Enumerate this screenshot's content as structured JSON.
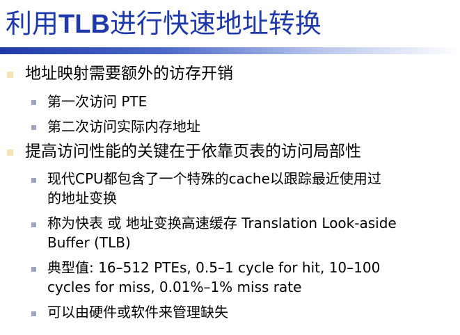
{
  "title": {
    "cn1": "利用",
    "latin": "TLB",
    "cn2": "进行快速地址转换"
  },
  "bullets": [
    {
      "text": "地址映射需要额外的访存开销",
      "children": [
        {
          "lines": [
            "第一次访问 PTE"
          ]
        },
        {
          "lines": [
            "第二次访问实际内存地址"
          ]
        }
      ]
    },
    {
      "text": "提高访问性能的关键在于依靠页表的访问局部性",
      "children": [
        {
          "lines": [
            "现代CPU都包含了一个特殊的cache以跟踪最近使用过",
            "的地址变换"
          ]
        },
        {
          "lines": [
            "称为快表 或 地址变换高速缓存 Translation Look-aside",
            "Buffer (TLB)"
          ]
        },
        {
          "lines": [
            "典型值: 16–512 PTEs, 0.5–1 cycle for hit, 10–100",
            "cycles for miss, 0.01%–1% miss rate"
          ]
        },
        {
          "lines": [
            "可以由硬件或软件来管理缺失"
          ]
        }
      ]
    }
  ],
  "colors": {
    "title": "#1f3aa8",
    "bullet_level1": "#f1e5b5",
    "bullet_level2": "#9ea7be"
  }
}
